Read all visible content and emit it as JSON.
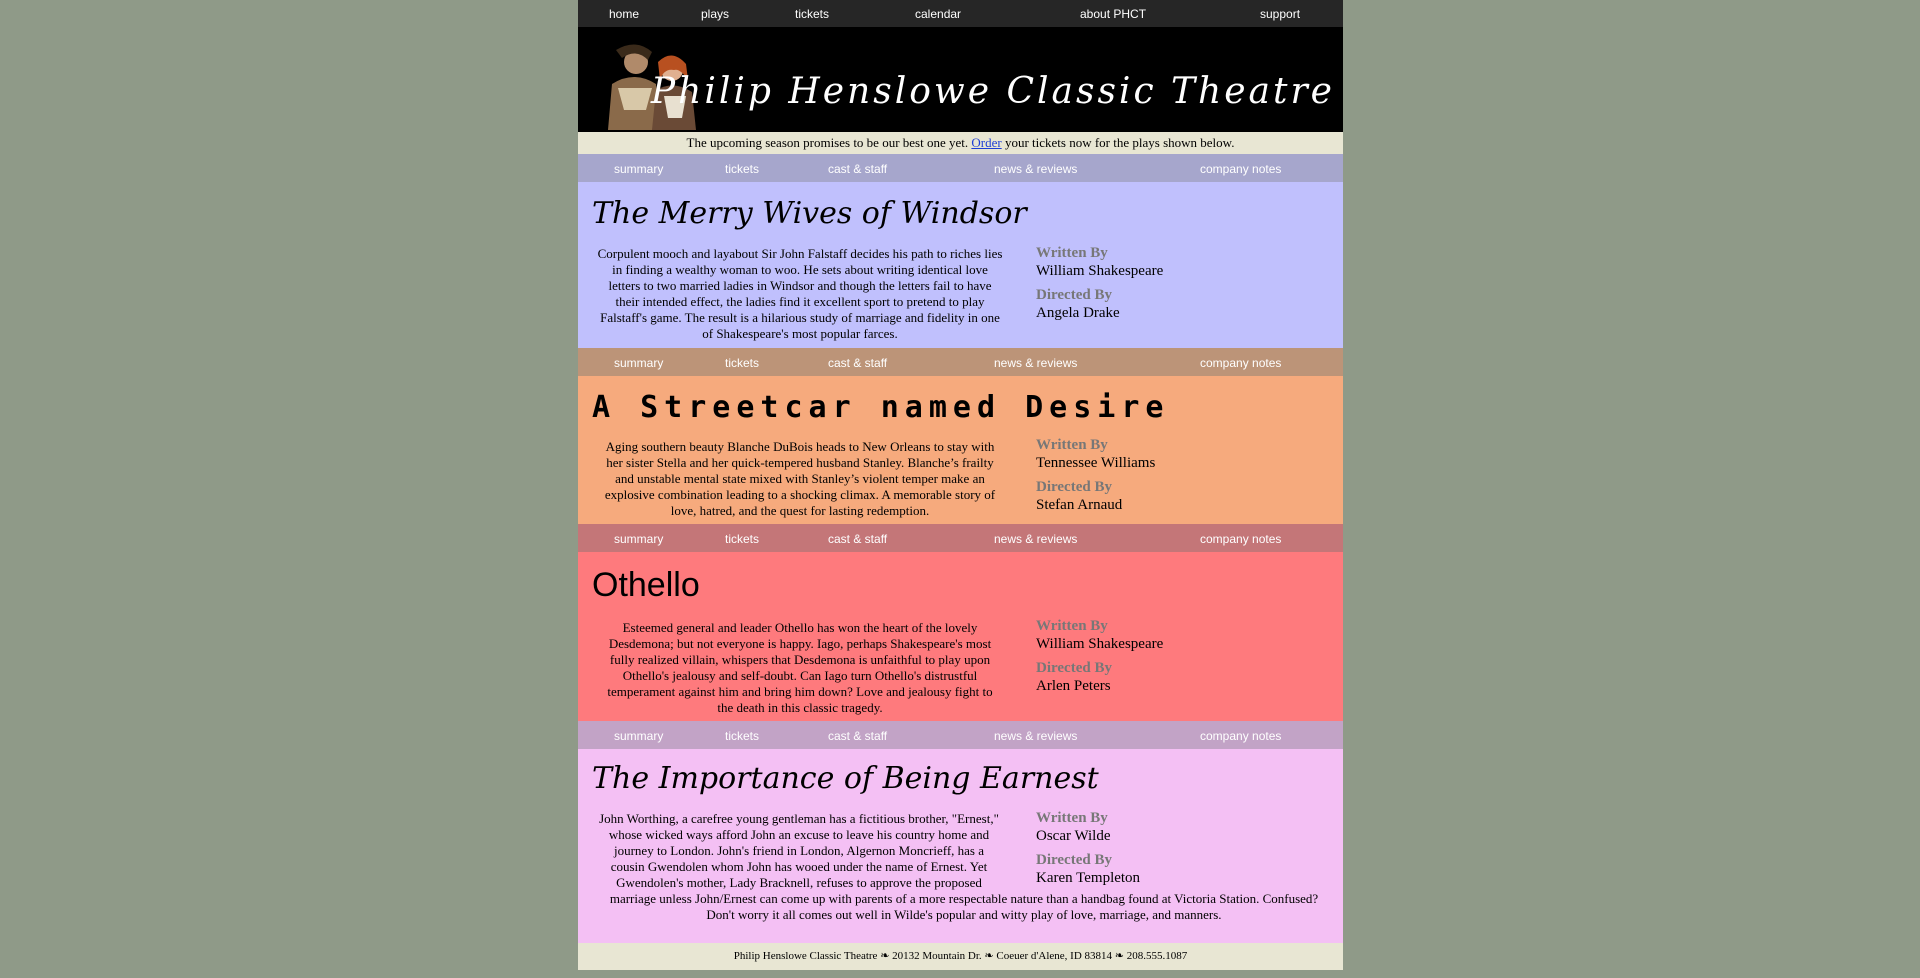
{
  "top_nav": {
    "home": "home",
    "plays": "plays",
    "tickets": "tickets",
    "calendar": "calendar",
    "about": "about PHCT",
    "support": "support"
  },
  "banner": {
    "logo_text": "Philip Henslowe Classic Theatre"
  },
  "announcement": {
    "before": "The upcoming season promises to be our best one yet. ",
    "link": "Order",
    "after": " your tickets now for the plays shown below."
  },
  "subnav": {
    "summary": "summary",
    "tickets": "tickets",
    "cast": "cast & staff",
    "news": "news & reviews",
    "notes": "company notes"
  },
  "credits_labels": {
    "written_by": "Written By",
    "directed_by": "Directed By"
  },
  "plays": [
    {
      "title": "The Merry Wives of Windsor",
      "summary": "Corpulent mooch and layabout Sir John Falstaff decides his path to riches lies in finding a wealthy woman to woo. He sets about writing identical love letters to two married ladies in Windsor and though the letters fail to have their intended effect, the ladies find it excellent sport to pretend to play Falstaff's game. The result is a hilarious study of marriage and fidelity in one of Shakespeare's most popular farces.",
      "writer": "William Shakespeare",
      "director": "Angela Drake",
      "bg": "#c0c0fd",
      "nav_bg": "#a6a6cc"
    },
    {
      "title": "A Streetcar named Desire",
      "summary": "Aging southern beauty Blanche DuBois heads to New Orleans to stay with her sister Stella and her quick-tempered husband Stanley. Blanche’s frailty and unstable mental state mixed with Stanley’s violent temper make an explosive combination leading to a shocking climax. A memorable story of love, hatred, and the quest for lasting redemption.",
      "writer": "Tennessee Williams",
      "director": "Stefan Arnaud",
      "bg": "#f6aa7d",
      "nav_bg": "#bc9478"
    },
    {
      "title": "Othello",
      "summary": "Esteemed general and leader Othello has won the heart of the lovely Desdemona; but not everyone is happy. Iago, perhaps Shakespeare's most fully realized villain, whispers that Desdemona is unfaithful to play upon Othello's jealousy and self-doubt. Can Iago turn Othello's distrustful temperament against him and bring him down? Love and jealousy fight to the death in this classic tragedy.",
      "writer": "William Shakespeare",
      "director": "Arlen Peters",
      "bg": "#fe7a7d",
      "nav_bg": "#c47678"
    },
    {
      "title": "The Importance of Being Earnest",
      "summary": "John Worthing, a carefree young gentleman has a fictitious brother, \"Ernest,\" whose wicked ways afford John an excuse to leave his country home and journey to London. John's friend in London, Algernon Moncrieff, has a cousin Gwendolen whom John has wooed under the name of Ernest. Yet Gwendolen's mother, Lady Bracknell, refuses to approve the proposed marriage unless John/Ernest can come up with parents of a more respectable nature than a handbag found at Victoria Station. Confused? Don't worry it all comes out well in Wilde's popular and witty play of love, marriage, and manners.",
      "writer": "Oscar Wilde",
      "director": "Karen Templeton",
      "bg": "#f4c0f4",
      "nav_bg": "#c2a3c6"
    }
  ],
  "footer": "Philip Henslowe Classic Theatre ❧ 20132 Mountain Dr. ❧ Coeuer d'Alene, ID 83814 ❧ 208.555.1087"
}
